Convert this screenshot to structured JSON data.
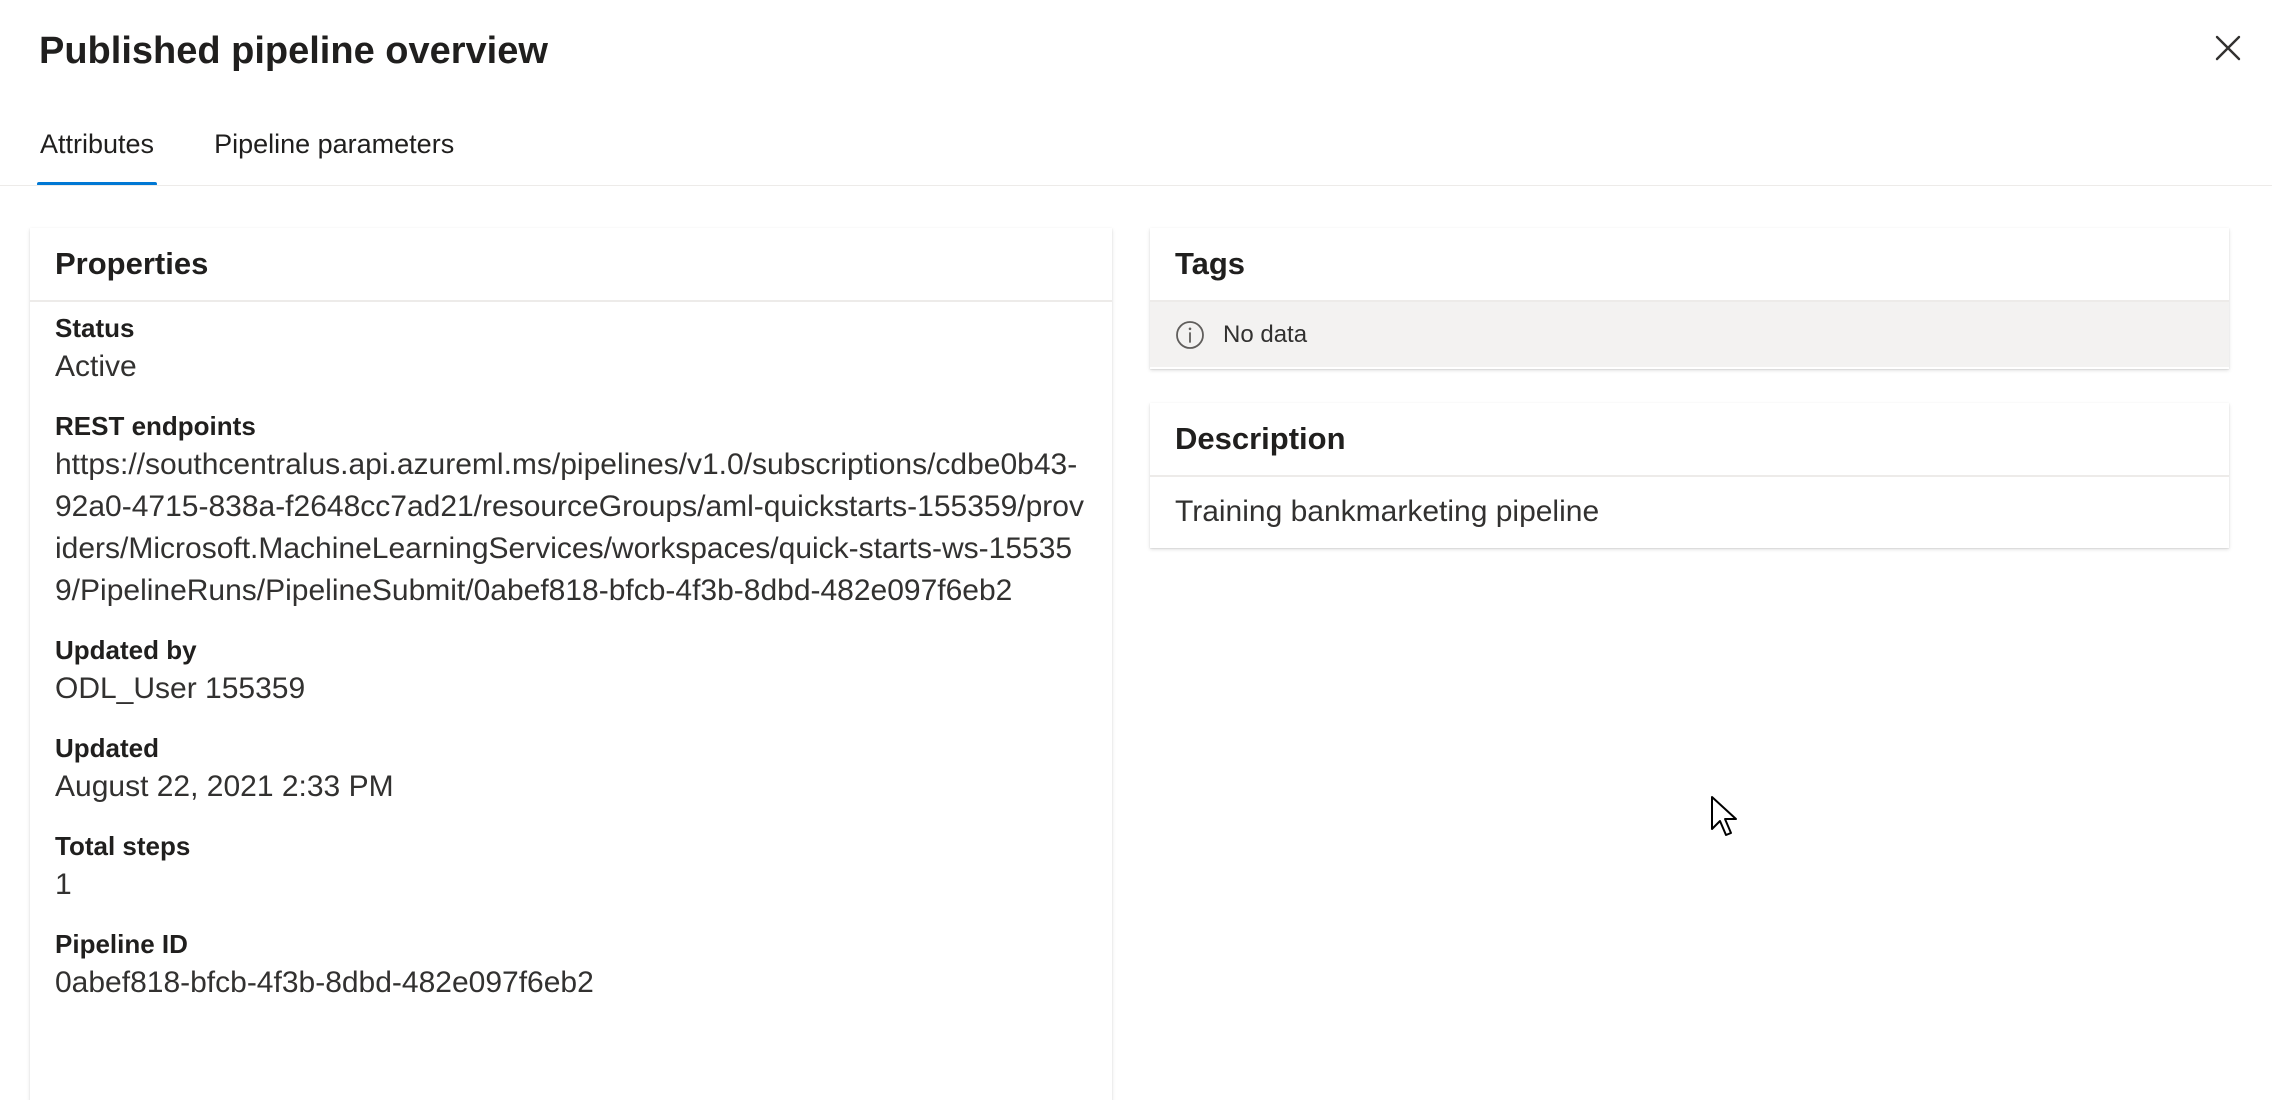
{
  "panel": {
    "title": "Published pipeline overview"
  },
  "tabs": [
    {
      "label": "Attributes",
      "active": true
    },
    {
      "label": "Pipeline parameters",
      "active": false
    }
  ],
  "properties": {
    "heading": "Properties",
    "status_label": "Status",
    "status_value": "Active",
    "rest_label": "REST endpoints",
    "rest_value": "https://southcentralus.api.azureml.ms/pipelines/v1.0/subscriptions/cdbe0b43-92a0-4715-838a-f2648cc7ad21/resourceGroups/aml-quickstarts-155359/providers/Microsoft.MachineLearningServices/workspaces/quick-starts-ws-155359/PipelineRuns/PipelineSubmit/0abef818-bfcb-4f3b-8dbd-482e097f6eb2",
    "updated_by_label": "Updated by",
    "updated_by_value": "ODL_User 155359",
    "updated_label": "Updated",
    "updated_value": "August 22, 2021 2:33 PM",
    "total_steps_label": "Total steps",
    "total_steps_value": "1",
    "pipeline_id_label": "Pipeline ID",
    "pipeline_id_value": "0abef818-bfcb-4f3b-8dbd-482e097f6eb2"
  },
  "tags": {
    "heading": "Tags",
    "empty_text": "No data"
  },
  "description": {
    "heading": "Description",
    "text": "Training bankmarketing pipeline"
  },
  "icons": {
    "close": "close-icon",
    "info": "info-icon",
    "cursor": "mouse-cursor-icon"
  },
  "colors": {
    "accent": "#0078d4",
    "text": "#201f1e",
    "muted_bg": "#f3f2f1",
    "divider": "#edebe9"
  }
}
